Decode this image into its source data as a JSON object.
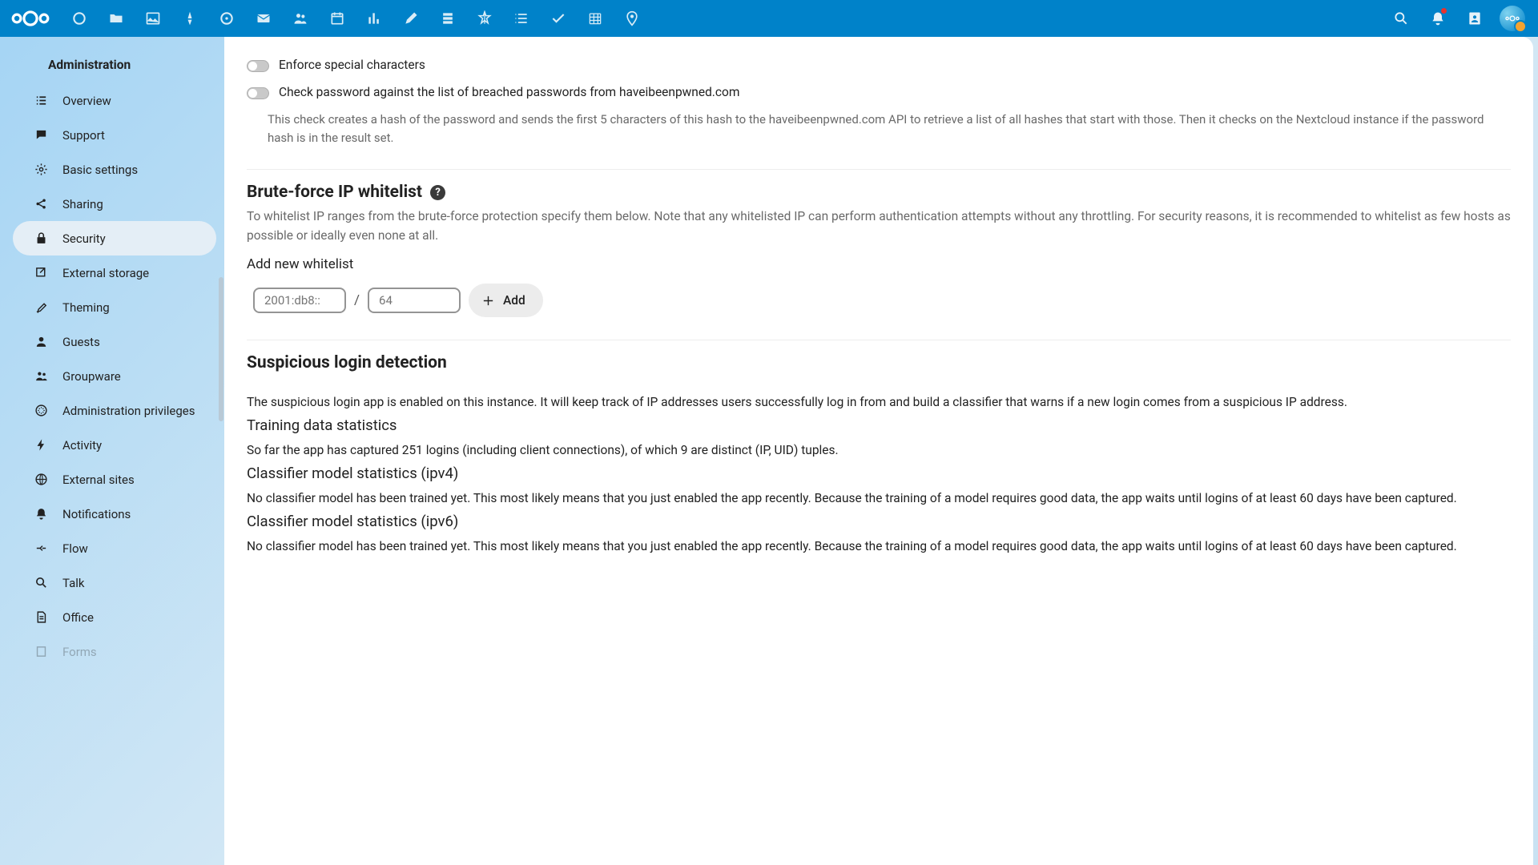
{
  "sidebar": {
    "heading": "Administration",
    "items": [
      {
        "label": "Overview"
      },
      {
        "label": "Support"
      },
      {
        "label": "Basic settings"
      },
      {
        "label": "Sharing"
      },
      {
        "label": "Security"
      },
      {
        "label": "External storage"
      },
      {
        "label": "Theming"
      },
      {
        "label": "Guests"
      },
      {
        "label": "Groupware"
      },
      {
        "label": "Administration privileges"
      },
      {
        "label": "Activity"
      },
      {
        "label": "External sites"
      },
      {
        "label": "Notifications"
      },
      {
        "label": "Flow"
      },
      {
        "label": "Talk"
      },
      {
        "label": "Office"
      },
      {
        "label": "Forms"
      }
    ]
  },
  "toggles": {
    "special_chars": "Enforce special characters",
    "hibp": "Check password against the list of breached passwords from haveibeenpwned.com",
    "hibp_hint": "This check creates a hash of the password and sends the first 5 characters of this hash to the haveibeenpwned.com API to retrieve a list of all hashes that start with those. Then it checks on the Nextcloud instance if the password hash is in the result set."
  },
  "bruteforce": {
    "title": "Brute-force IP whitelist",
    "desc": "To whitelist IP ranges from the brute-force protection specify them below. Note that any whitelisted IP can perform authentication attempts without any throttling. For security reasons, it is recommended to whitelist as few hosts as possible or ideally even none at all.",
    "add_label": "Add new whitelist",
    "ip_placeholder": "2001:db8::",
    "mask_placeholder": "64",
    "slash": "/",
    "add_btn": "Add"
  },
  "suspicious": {
    "title": "Suspicious login detection",
    "desc": "The suspicious login app is enabled on this instance. It will keep track of IP addresses users successfully log in from and build a classifier that warns if a new login comes from a suspicious IP address.",
    "train_h": "Training data statistics",
    "train_txt": "So far the app has captured 251 logins (including client connections), of which 9 are distinct (IP, UID) tuples.",
    "ipv4_h": "Classifier model statistics (ipv4)",
    "ipv4_txt": "No classifier model has been trained yet. This most likely means that you just enabled the app recently. Because the training of a model requires good data, the app waits until logins of at least 60 days have been captured.",
    "ipv6_h": "Classifier model statistics (ipv6)",
    "ipv6_txt": "No classifier model has been trained yet. This most likely means that you just enabled the app recently. Because the training of a model requires good data, the app waits until logins of at least 60 days have been captured."
  }
}
